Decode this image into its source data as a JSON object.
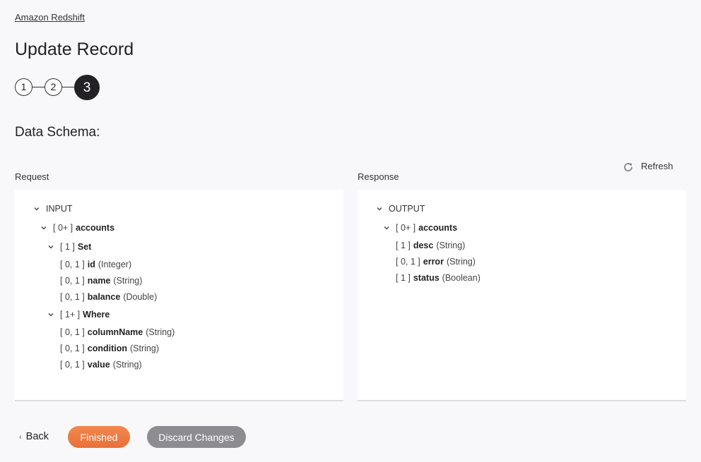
{
  "breadcrumb": "Amazon Redshift",
  "title": "Update Record",
  "stepper": {
    "steps": [
      "1",
      "2",
      "3"
    ],
    "current": 3
  },
  "section_title": "Data Schema:",
  "refresh_label": "Refresh",
  "request": {
    "label": "Request",
    "tree": {
      "root": "INPUT",
      "accounts": {
        "card": "[ 0+ ]",
        "name": "accounts"
      },
      "set": {
        "card": "[ 1 ]",
        "name": "Set"
      },
      "set_fields": [
        {
          "card": "[ 0, 1 ]",
          "name": "id",
          "type": "(Integer)"
        },
        {
          "card": "[ 0, 1 ]",
          "name": "name",
          "type": "(String)"
        },
        {
          "card": "[ 0, 1 ]",
          "name": "balance",
          "type": "(Double)"
        }
      ],
      "where": {
        "card": "[ 1+ ]",
        "name": "Where"
      },
      "where_fields": [
        {
          "card": "[ 0, 1 ]",
          "name": "columnName",
          "type": "(String)"
        },
        {
          "card": "[ 0, 1 ]",
          "name": "condition",
          "type": "(String)"
        },
        {
          "card": "[ 0, 1 ]",
          "name": "value",
          "type": "(String)"
        }
      ]
    }
  },
  "response": {
    "label": "Response",
    "tree": {
      "root": "OUTPUT",
      "accounts": {
        "card": "[ 0+ ]",
        "name": "accounts"
      },
      "fields": [
        {
          "card": "[ 1 ]",
          "name": "desc",
          "type": "(String)"
        },
        {
          "card": "[ 0, 1 ]",
          "name": "error",
          "type": "(String)"
        },
        {
          "card": "[ 1 ]",
          "name": "status",
          "type": "(Boolean)"
        }
      ]
    }
  },
  "footer": {
    "back_label": "Back",
    "finish_label": "Finished",
    "discard_label": "Discard Changes"
  },
  "colors": {
    "finish": "#ee7c44",
    "discard": "#8d8c91",
    "active_step": "#232125"
  }
}
